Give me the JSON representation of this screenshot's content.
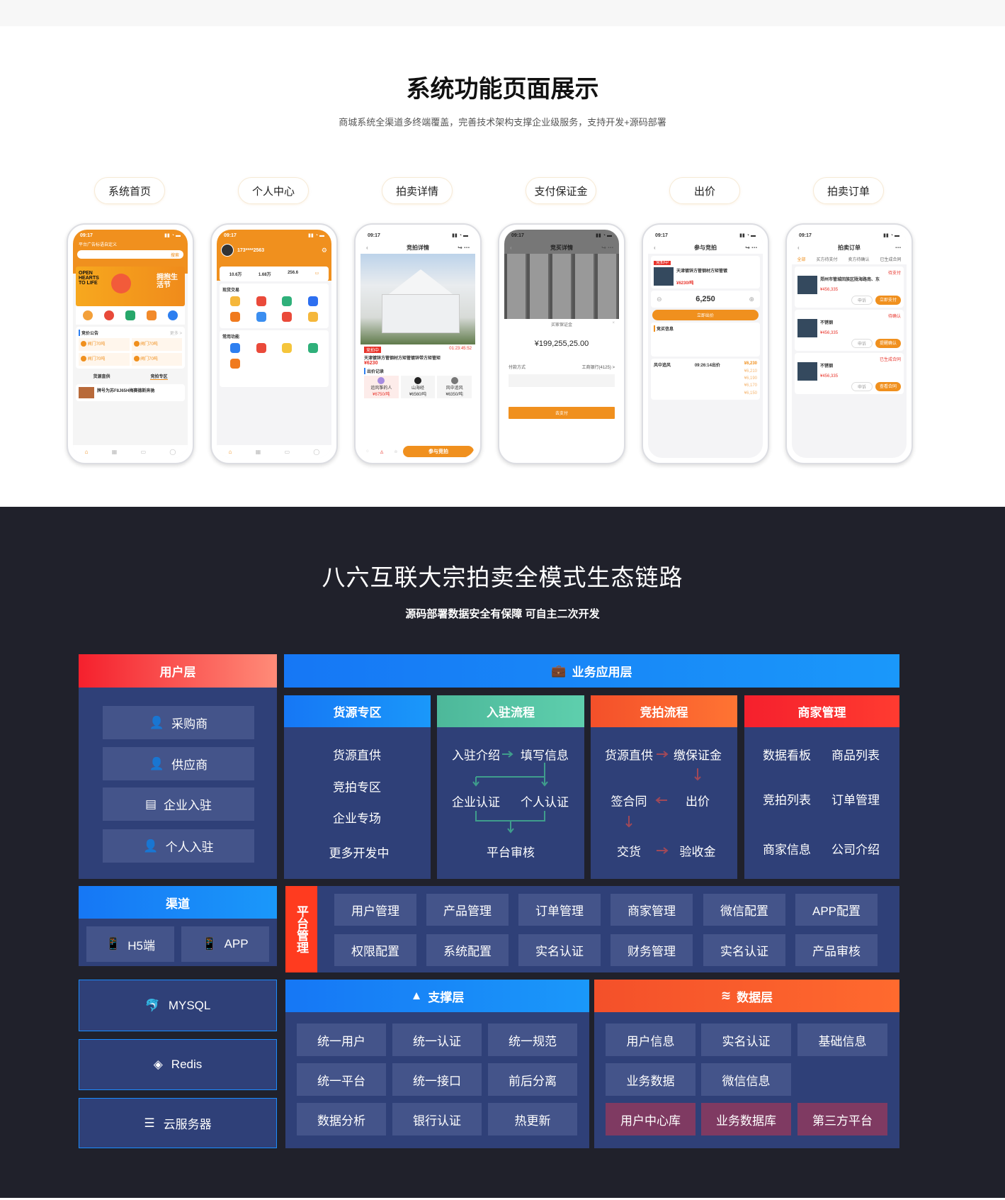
{
  "showcase": {
    "title": "系统功能页面展示",
    "subtitle": "商城系统全渠道多终端覆盖，完善技术架构支撑企业级服务，支持开发+源码部署",
    "tabs": [
      "系统首页",
      "个人中心",
      "拍卖详情",
      "支付保证金",
      "出价",
      "拍卖订单"
    ],
    "status_time": "09:17",
    "home": {
      "slogan": "平台广告标语自定义",
      "search_btn": "搜索",
      "banner_en": "OPEN HEARTS TO LIFE",
      "banner_cn": "拥抱生活节",
      "notice_title": "竞价公告",
      "notice_more": "更多 >",
      "notice_item": "阀门70吨",
      "tabs": [
        "货源直供",
        "竞拍专区"
      ],
      "listing": "牌号为苏F8J65H梅赛德斯奔驰"
    },
    "profile": {
      "phone": "173****2563",
      "stats": [
        "10.6万",
        "1.68万",
        "256.6"
      ],
      "section1": "现货交易",
      "section2": "常用功能"
    },
    "detail": {
      "nav": "竞拍详情",
      "badge": "竞拍中",
      "countdown": [
        "01",
        "23",
        "45",
        "52"
      ],
      "product": "天津镀锌方管钢材方矩管镀锌带方矩管矩",
      "price": "¥6230",
      "records": "出价记录",
      "bidders": [
        {
          "name": "追风筝的人",
          "price": "¥6750/吨"
        },
        {
          "name": "山海经",
          "price": "¥6560/吨"
        },
        {
          "name": "风中追风",
          "price": "¥6350/吨"
        }
      ],
      "cta": "参与竞拍"
    },
    "deposit": {
      "nav": "竞买详情",
      "sheet_title": "买家保证金",
      "amount": "¥199,255,25.00",
      "pay_label": "付款方式",
      "pay_method": "工商银行(4125) >",
      "pay_btn": "去支付"
    },
    "bid": {
      "nav": "参与竞拍",
      "badge": "竞拍中",
      "product": "天津镀锌方管钢材方矩管镀",
      "price": "¥6230/吨",
      "amount": "6,250",
      "bid_btn": "立即出价",
      "info_title": "竞买信息",
      "top_bidder": "风中追风",
      "top_time": "09:26:14出价",
      "top_price": "¥6,230",
      "history": [
        "¥6,210",
        "¥6,190",
        "¥6,170",
        "¥6,150"
      ]
    },
    "orders": {
      "nav": "拍卖订单",
      "tabs": [
        "全部",
        "买方待支付",
        "卖方待确认",
        "已生成合同"
      ],
      "items": [
        {
          "status": "待支付",
          "name": "郑州市管城回族区陇海路南、东",
          "price": "¥456,335",
          "action": "立即支付"
        },
        {
          "status": "待确认",
          "name": "不锈钢",
          "price": "¥456,335",
          "action": "提醒确认"
        },
        {
          "status": "已生成合同",
          "name": "不锈钢",
          "price": "¥456,335",
          "action": "查看合同"
        }
      ],
      "appeal": "申诉"
    }
  },
  "ecosystem": {
    "title": "八六互联大宗拍卖全模式生态链路",
    "subtitle": "源码部署数据安全有保障  可自主二次开发",
    "user_layer": {
      "title": "用户层",
      "items": [
        "采购商",
        "供应商",
        "企业入驻",
        "个人入驻"
      ]
    },
    "business_layer": {
      "title": "业务应用层",
      "supply": {
        "title": "货源专区",
        "items": [
          "货源直供",
          "竞拍专区",
          "企业专场",
          "更多开发中"
        ]
      },
      "onboarding": {
        "title": "入驻流程",
        "intro": "入驻介绍",
        "fill": "填写信息",
        "company": "企业认证",
        "personal": "个人认证",
        "review": "平台审核"
      },
      "auction": {
        "title": "竞拍流程",
        "supply": "货源直供",
        "deposit": "缴保证金",
        "contract": "签合同",
        "bid": "出价",
        "delivery": "交货",
        "accept": "验收金"
      },
      "merchant": {
        "title": "商家管理",
        "items": [
          "数据看板",
          "商品列表",
          "竞拍列表",
          "订单管理",
          "商家信息",
          "公司介绍"
        ]
      }
    },
    "channel": {
      "title": "渠道",
      "items": [
        "H5端",
        "APP"
      ]
    },
    "platform": {
      "title": "平台管理",
      "items": [
        "用户管理",
        "产品管理",
        "订单管理",
        "商家管理",
        "微信配置",
        "APP配置",
        "权限配置",
        "系统配置",
        "实名认证",
        "财务管理",
        "实名认证",
        "产品审核"
      ]
    },
    "storage": [
      "MYSQL",
      "Redis",
      "云服务器"
    ],
    "support_layer": {
      "title": "支撑层",
      "items": [
        "统一用户",
        "统一认证",
        "统一规范",
        "统一平台",
        "统一接口",
        "前后分离",
        "数据分析",
        "银行认证",
        "热更新"
      ]
    },
    "data_layer": {
      "title": "数据层",
      "items": [
        "用户信息",
        "实名认证",
        "基础信息",
        "业务数据",
        "微信信息"
      ],
      "stores": [
        "用户中心库",
        "业务数据库",
        "第三方平台"
      ]
    },
    "colors": {
      "background": "#20212b",
      "panel": "#2f4078",
      "button": "#44548a",
      "store": "#7f3a62",
      "blue": "#1677f5",
      "red": "#f5222d",
      "green": "#4db89a",
      "orange": "#f4502a",
      "accent": "#f0901e"
    }
  }
}
